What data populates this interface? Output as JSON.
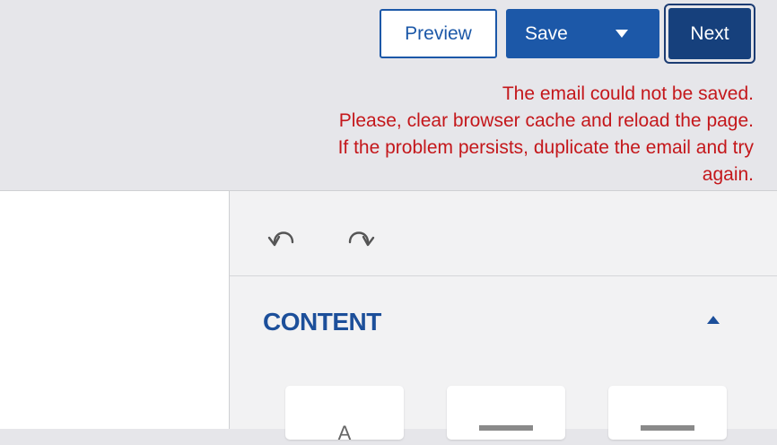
{
  "toolbar": {
    "preview_label": "Preview",
    "save_label": "Save",
    "next_label": "Next"
  },
  "error": {
    "lines": [
      "The email could not be saved.",
      "Please, clear browser cache and reload the page.",
      "If the problem persists, duplicate the email and try",
      "again."
    ]
  },
  "history": {
    "undo_icon": "undo-icon",
    "redo_icon": "redo-icon"
  },
  "sidebar": {
    "section_title": "CONTENT",
    "section_collapse_icon": "caret-up-icon",
    "blocks": [
      {
        "icon": "text-block-icon",
        "glyph": "A"
      },
      {
        "icon": "image-block-icon"
      },
      {
        "icon": "button-block-icon"
      }
    ]
  },
  "colors": {
    "primary": "#1c58a8",
    "primary_dark": "#16407c",
    "error": "#c4171b",
    "heading": "#1c4f9a"
  }
}
